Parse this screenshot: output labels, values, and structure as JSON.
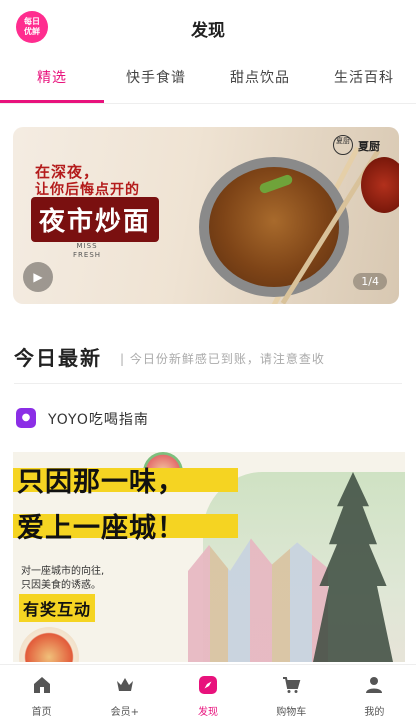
{
  "header": {
    "logo_line1": "每日",
    "logo_line2": "优鲜",
    "title": "发现"
  },
  "tabs": [
    {
      "label": "精选",
      "active": true
    },
    {
      "label": "快手食谱",
      "active": false
    },
    {
      "label": "甜点饮品",
      "active": false
    },
    {
      "label": "生活百科",
      "active": false
    }
  ],
  "banner": {
    "line1": "在深夜，",
    "line2": "让你后悔点开的",
    "main": "夜市炒面",
    "brand_line1": "MISS",
    "brand_line2": "FRESH",
    "badge_text": "夏厨",
    "brand_name": "夏厨",
    "pager": "1/4"
  },
  "section": {
    "title": "今日最新",
    "subtitle": "今日份新鲜感已到账，请注意查收"
  },
  "feed_item": {
    "author": "YOYO吃喝指南",
    "poster_line1": "只因那一味，",
    "poster_line2": "爱上一座城！",
    "poster_sub1": "对一座城市的向往,",
    "poster_sub2": "只因美食的诱惑。",
    "poster_cta": "有奖互动"
  },
  "tabbar": [
    {
      "label": "首页",
      "icon": "home-icon",
      "active": false
    },
    {
      "label": "会员+",
      "icon": "crown-icon",
      "active": false
    },
    {
      "label": "发现",
      "icon": "compass-icon",
      "active": true
    },
    {
      "label": "购物车",
      "icon": "cart-icon",
      "active": false
    },
    {
      "label": "我的",
      "icon": "user-icon",
      "active": false
    }
  ],
  "colors": {
    "accent": "#e8127c",
    "poster_highlight": "#f5d422"
  }
}
